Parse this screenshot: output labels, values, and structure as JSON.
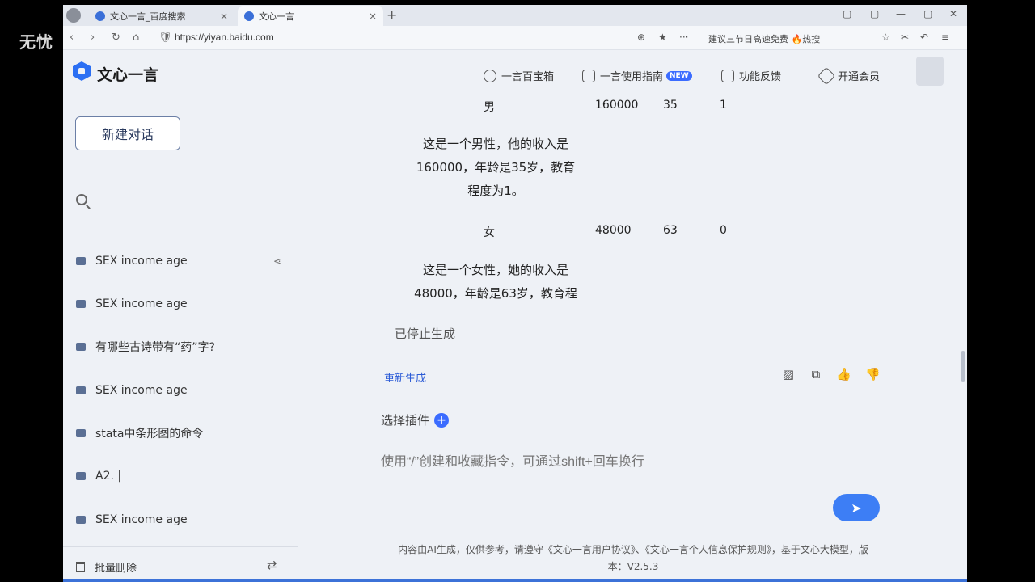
{
  "watermark": "无忧",
  "tabs": [
    {
      "label": "文心一言_百度搜索",
      "close": "×"
    },
    {
      "label": "文心一言",
      "close": "×"
    }
  ],
  "new_tab": "+",
  "window_controls": [
    "▢",
    "▢",
    "—",
    "▢",
    "✕"
  ],
  "address": {
    "nav": [
      "‹",
      "›",
      "↻",
      "⌂"
    ],
    "url": "https://yiyan.baidu.com",
    "hot_suggest": "建议三节日高速免费 🔥热搜",
    "right_icons": [
      "⊕",
      "★",
      "···"
    ]
  },
  "header": {
    "logo": "文心一言",
    "items": [
      "一言百宝箱",
      "一言使用指南",
      "功能反馈",
      "开通会员"
    ],
    "new_badge": "NEW"
  },
  "sidebar": {
    "new_chat": "新建对话",
    "search_placeholder": "",
    "history": [
      "SEX income age",
      "SEX income age",
      "有哪些古诗带有“药”字?",
      "SEX income age",
      "stata中条形图的命令",
      "A2. |",
      "SEX income age"
    ],
    "bulk_delete": "批量删除"
  },
  "main": {
    "row1": {
      "sex": "男",
      "income": "160000",
      "age": "35",
      "edu": "1"
    },
    "para1": [
      "这是一个男性，他的收入是",
      "160000，年龄是35岁，教育",
      "程度为1。"
    ],
    "row2": {
      "sex": "女",
      "income": "48000",
      "age": "63",
      "edu": "0"
    },
    "para2": [
      "这是一个女性，她的收入是",
      "48000，年龄是63岁，教育程"
    ],
    "stopped": "已停止生成",
    "regen": "重新生成",
    "plugin": "选择插件",
    "prompt_placeholder": "使用“/”创建和收藏指令，可通过shift+回车换行",
    "disclaimer_line1": "内容由AI生成，仅供参考，请遵守《文心一言用户协议》、《文心一言个人信息保护规则》，基于文心大模型，版",
    "disclaimer_line2": "本：V2.5.3"
  }
}
